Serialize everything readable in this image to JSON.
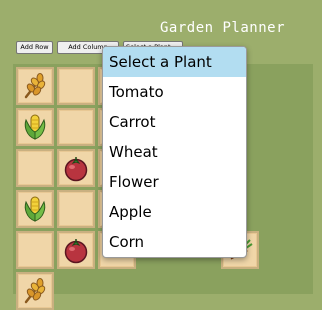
{
  "app": {
    "title": "Garden Planner"
  },
  "toolbar": {
    "add_row_label": "Add Row",
    "add_column_label": "Add Column",
    "select_value": "Select a Plant"
  },
  "dropdown": {
    "options": [
      "Select a Plant",
      "Tomato",
      "Carrot",
      "Wheat",
      "Flower",
      "Apple",
      "Corn"
    ],
    "selected_index": 0
  },
  "grid": {
    "rows": [
      [
        "wheat",
        "empty",
        "empty",
        "",
        "",
        "",
        ""
      ],
      [
        "corn",
        "empty",
        "empty",
        "",
        "",
        "",
        ""
      ],
      [
        "empty",
        "tomato",
        "empty",
        "",
        "",
        "",
        ""
      ],
      [
        "corn",
        "empty",
        "empty",
        "",
        "",
        "",
        ""
      ],
      [
        "empty",
        "tomato",
        "empty",
        "",
        "",
        "carrot",
        ""
      ],
      [
        "wheat",
        "",
        "",
        "",
        "",
        "",
        ""
      ]
    ]
  },
  "colors": {
    "background": "#9cae6c",
    "tile": "#f0d6a8",
    "dropdown_highlight": "#b2ddf1"
  }
}
